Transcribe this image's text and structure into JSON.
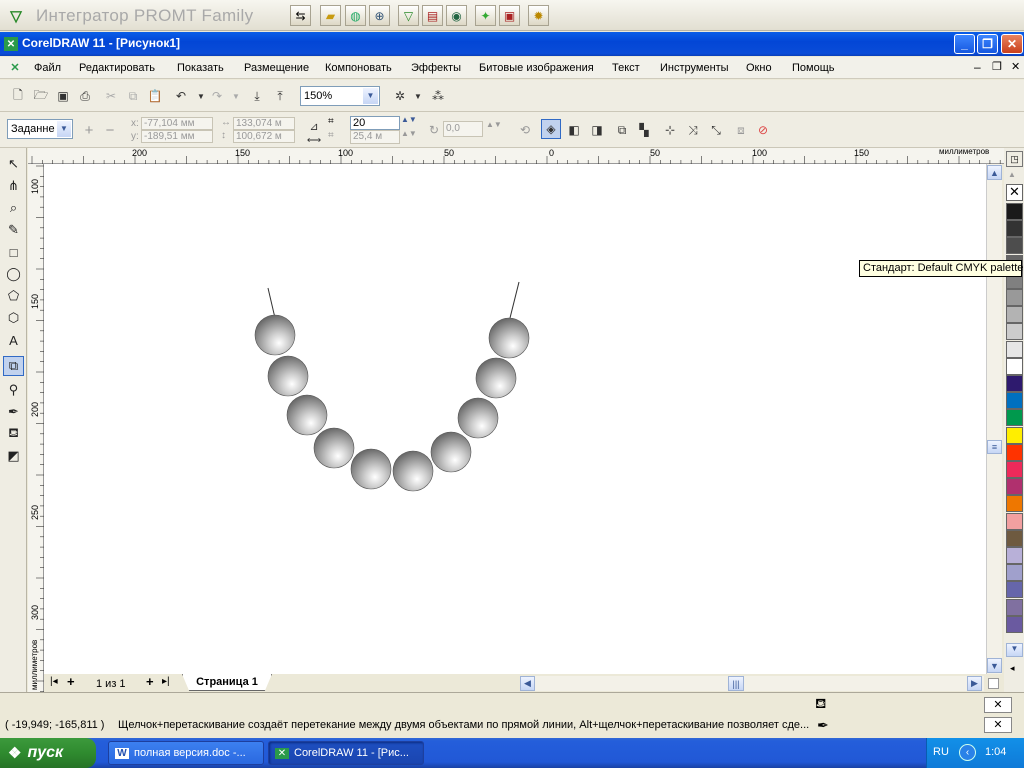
{
  "promt": {
    "title": "Интегратор PROMT Family",
    "buttons": [
      "translate-doc-icon",
      "open-folder-icon",
      "globe-translate-icon",
      "globe-search-icon",
      "funnel-icon",
      "dictionary-icon",
      "world-icon",
      "lightbulb-icon",
      "book-icon",
      "settings-icon"
    ]
  },
  "window": {
    "title": "CorelDRAW 11 - [Рисунок1]"
  },
  "menu": {
    "items": [
      "Файл",
      "Редактировать",
      "Показать",
      "Размещение",
      "Компоновать",
      "Эффекты",
      "Битовые изображения",
      "Текст",
      "Инструменты",
      "Окно",
      "Помощь"
    ]
  },
  "standard_toolbar": {
    "zoom": "150%"
  },
  "property_bar": {
    "preset": "Заданне",
    "x_label": "x:",
    "x": "-77,104 мм",
    "y_label": "y:",
    "y": "-189,51 мм",
    "width": "133,074 м",
    "height": "100,672 м",
    "steps": "20",
    "spacing": "25,4 м",
    "angle": "0,0"
  },
  "rulers": {
    "h_labels": [
      "200",
      "150",
      "100",
      "50",
      "0",
      "50",
      "100",
      "150"
    ],
    "h_unit": "миллиметров",
    "v_labels": [
      "100",
      "150",
      "200",
      "250",
      "300"
    ],
    "v_unit": "миллиметров"
  },
  "tooltip": {
    "text": "Стандарт: Default CMYK palette"
  },
  "palette": {
    "colors": [
      "#1a1a1a",
      "#333333",
      "#4d4d4d",
      "#666666",
      "#808080",
      "#999999",
      "#b3b3b3",
      "#cccccc",
      "#e6e6e6",
      "#ffffff",
      "#2e1a6e",
      "#0070c0",
      "#00994d",
      "#ffee00",
      "#ff3300",
      "#ee2a5a",
      "#b0306e",
      "#ee7700",
      "#f2a0a0",
      "#6e5a40",
      "#b8b0d8",
      "#a0a0cc",
      "#6666aa",
      "#8070a0",
      "#6a5aa0"
    ]
  },
  "pagebar": {
    "page_count": "1 из 1",
    "page_tab": "Страница 1"
  },
  "status": {
    "coords": "( -19,949; -165,811 )",
    "hint": "Щелчок+перетаскивание создаёт перетекание между двумя объектами по прямой линии, Alt+щелчок+перетаскивание позволяет сде..."
  },
  "taskbar": {
    "start": "пуск",
    "tasks": [
      "полная версия.doc -...",
      "CorelDRAW 11 - [Рис..."
    ],
    "lang": "RU",
    "clock": "1:04"
  }
}
